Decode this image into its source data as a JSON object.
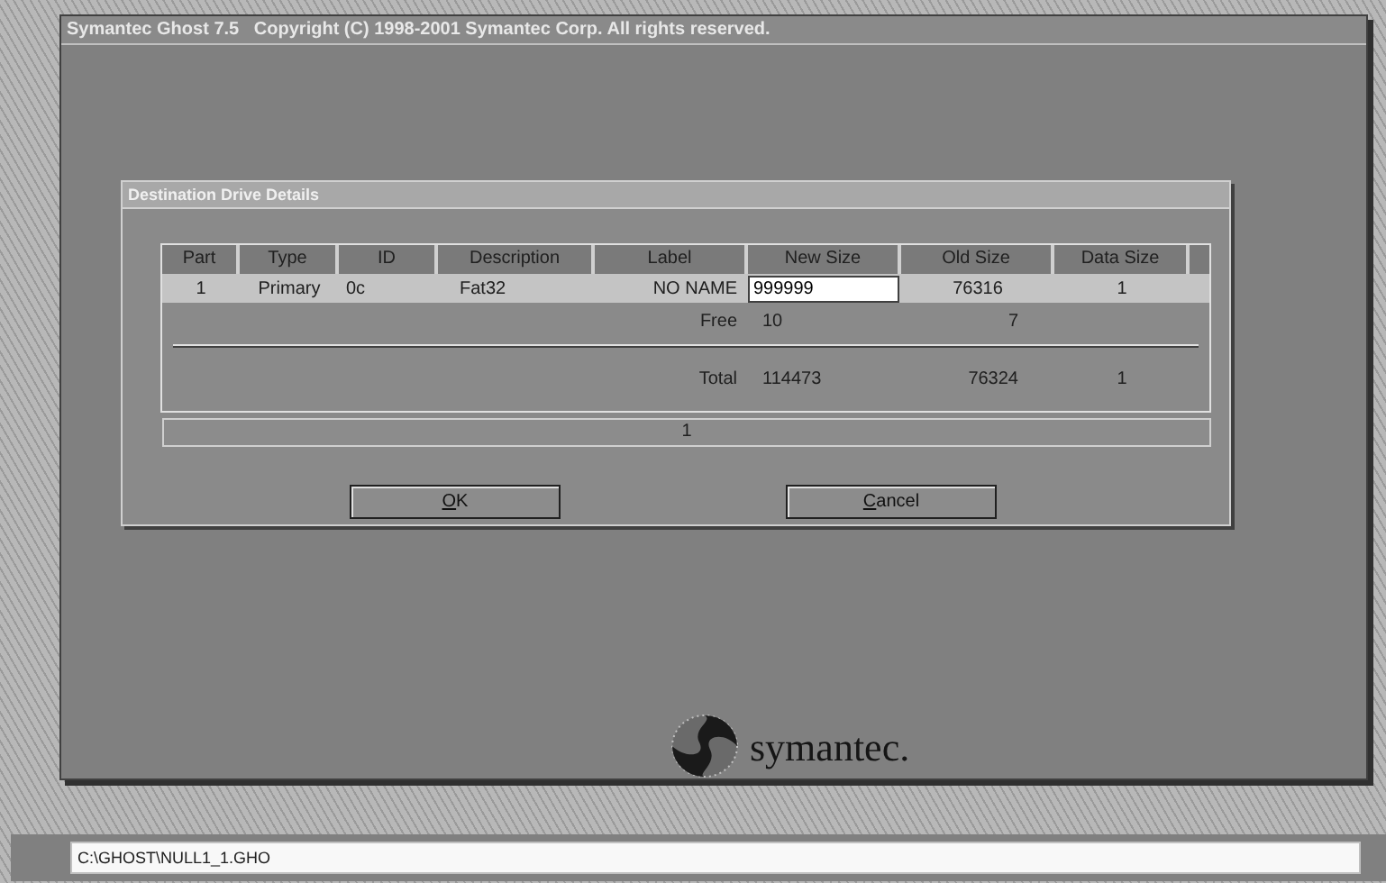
{
  "window": {
    "title": "Symantec Ghost 7.5   Copyright (C) 1998-2001 Symantec Corp. All rights reserved."
  },
  "dialog": {
    "title": "Destination Drive Details",
    "table": {
      "columns": [
        "Part",
        "Type",
        "ID",
        "Description",
        "Label",
        "New Size",
        "Old Size",
        "Data Size"
      ],
      "rows": [
        {
          "part": "1",
          "type": "Primary",
          "id": "0c",
          "description": "Fat32",
          "label": "NO NAME",
          "new_size": "999999",
          "old_size": "76316",
          "data_size": "1",
          "selected": true
        }
      ],
      "free": {
        "label": "Free",
        "new_size": "10",
        "old_size": "7"
      },
      "total": {
        "label": "Total",
        "new_size": "114473",
        "old_size": "76324",
        "data_size": "1"
      }
    },
    "status": "1",
    "buttons": [
      {
        "label": "OK",
        "underline_first": true
      },
      {
        "label": "Cancel",
        "underline_first": true
      }
    ]
  },
  "logo": {
    "text": "symantec."
  },
  "status_bar": {
    "path": "C:\\GHOST\\NULL1_1.GHO"
  }
}
